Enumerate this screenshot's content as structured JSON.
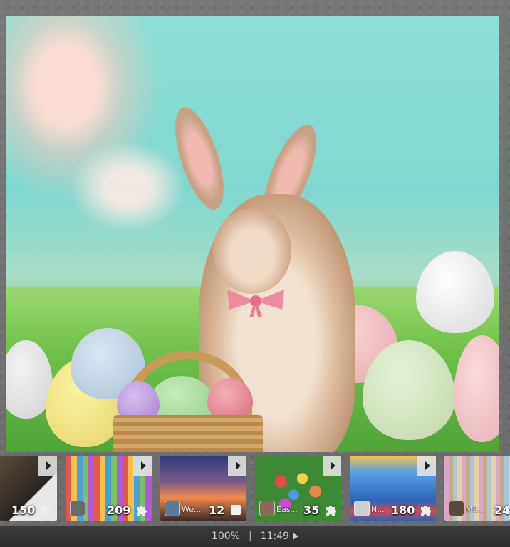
{
  "puzzle": {
    "colors": {
      "sky": "#8fe0d6",
      "grass": "#5eb84a"
    }
  },
  "thumbnails": [
    {
      "count": "150",
      "name": "",
      "icon": "puzzle-piece-icon",
      "bg": "#3a3228"
    },
    {
      "count": "209",
      "name": "",
      "icon": "puzzle-piece-icon",
      "bg": "#c9a25a"
    },
    {
      "count": "12",
      "name": "We...",
      "icon": "square-icon",
      "bg": "#2d3560"
    },
    {
      "count": "35",
      "name": "Eas...",
      "icon": "puzzle-piece-icon",
      "bg": "#3c8a34"
    },
    {
      "count": "180",
      "name": "N...",
      "icon": "puzzle-piece-icon",
      "bg": "#2a63b8"
    },
    {
      "count": "24",
      "name": "Ma...",
      "icon": "",
      "bg": "#c7a98a"
    }
  ],
  "status": {
    "zoom": "100%",
    "separator": "|",
    "time": "11:49"
  }
}
